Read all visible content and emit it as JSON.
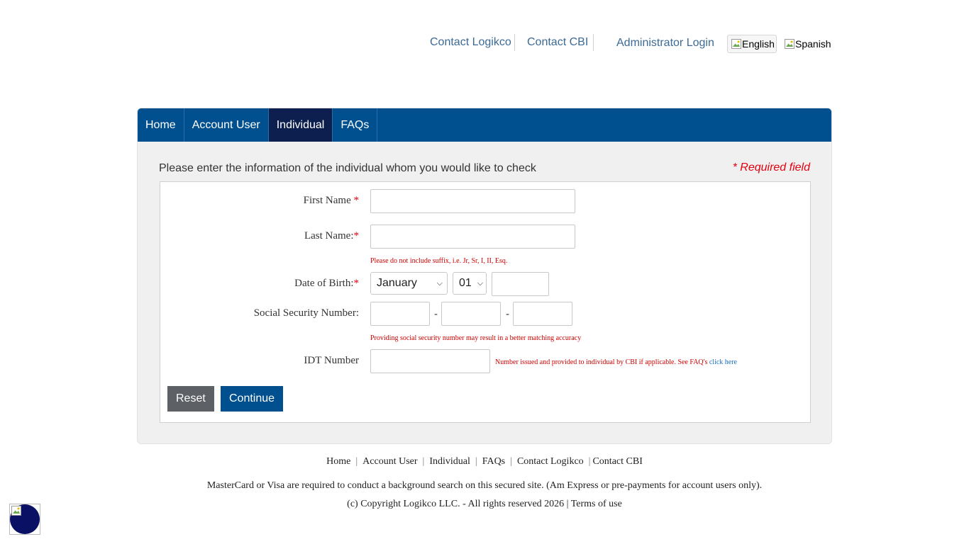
{
  "header": {
    "links": [
      "Contact Logikco",
      "Contact CBI",
      "Administrator Login"
    ],
    "languages": [
      {
        "label": "English",
        "active": true
      },
      {
        "label": "Spanish",
        "active": false
      }
    ]
  },
  "nav": {
    "tabs": [
      {
        "label": "Home",
        "active": false
      },
      {
        "label": "Account User",
        "active": false
      },
      {
        "label": "Individual",
        "active": true
      },
      {
        "label": "FAQs",
        "active": false
      }
    ]
  },
  "form": {
    "instruction": "Please enter the information of the individual whom you would like to check",
    "required_note": "* Required field",
    "first_name": {
      "label": "First Name",
      "star": "*",
      "value": ""
    },
    "last_name": {
      "label": "Last Name:",
      "star": "*",
      "value": ""
    },
    "suffix_hint": "Please do not include suffix, i.e. Jr, Sr, I, II, Esq.",
    "dob": {
      "label": "Date of Birth:",
      "star": "*",
      "month": "January",
      "day": "01",
      "year": ""
    },
    "ssn": {
      "label": "Social Security Number:",
      "dash": "-",
      "part1": "",
      "part2": "",
      "part3": ""
    },
    "ssn_hint": "Providing social security number may result in a better matching accuracy",
    "idt": {
      "label": "IDT Number",
      "value": "",
      "hint": "Number issued and provided to individual by CBI if applicable. See FAQ's ",
      "hint_link": "click here"
    },
    "buttons": {
      "reset": "Reset",
      "continue": "Continue"
    }
  },
  "footer": {
    "links": [
      "Home",
      "Account User",
      "Individual",
      "FAQs",
      "Contact Logikco",
      "Contact CBI"
    ],
    "separator": "|",
    "payment_note": "MasterCard or Visa are required to conduct a background search on this secured site. (Am Express or pre-payments for account users only).",
    "copyright": "(c) Copyright Logikco LLC. - All rights reserved 2026 | ",
    "terms": "Terms of use"
  },
  "colors": {
    "nav_bg": "#004f8e",
    "nav_active": "#0c1f4f",
    "link": "#3c6a96",
    "required": "#e3000f",
    "reset_btn": "#5d6166",
    "continue_btn": "#004f8e"
  }
}
